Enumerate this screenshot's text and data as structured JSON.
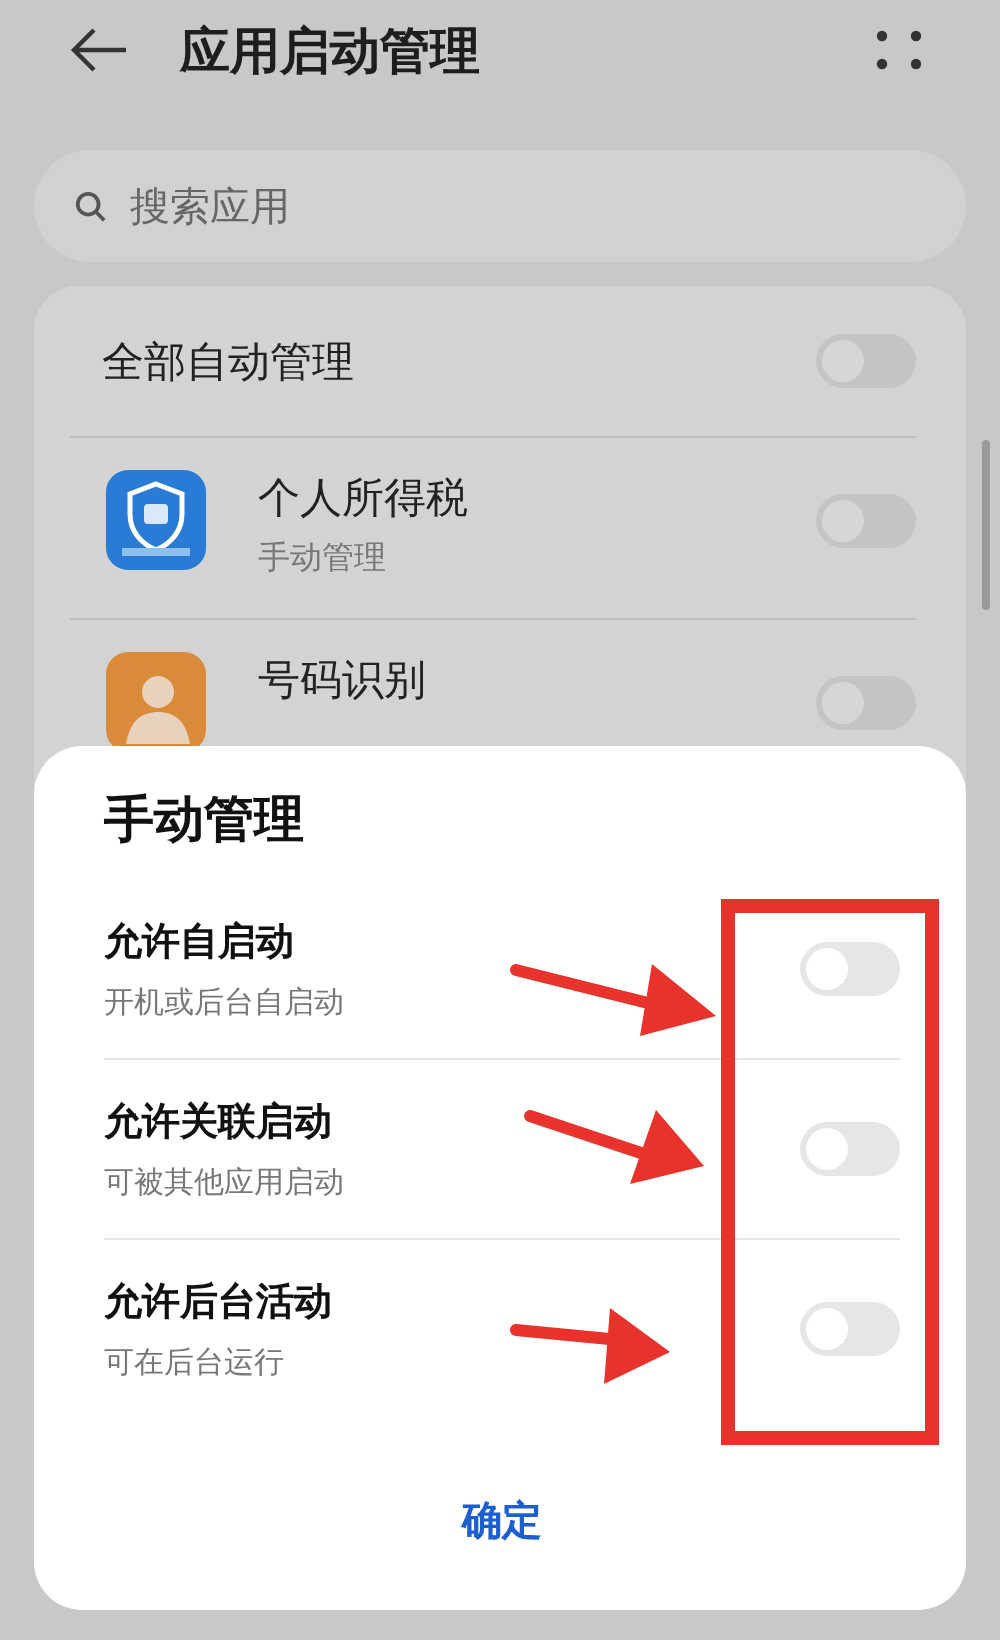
{
  "header": {
    "title": "应用启动管理"
  },
  "search": {
    "placeholder": "搜索应用"
  },
  "all_auto": {
    "label": "全部自动管理",
    "on": false
  },
  "apps": [
    {
      "name": "个人所得税",
      "status": "手动管理",
      "on": false
    },
    {
      "name": "号码识别",
      "on": false
    }
  ],
  "dialog": {
    "title": "手动管理",
    "options": [
      {
        "label": "允许自启动",
        "description": "开机或后台自启动",
        "on": false
      },
      {
        "label": "允许关联启动",
        "description": "可被其他应用启动",
        "on": false
      },
      {
        "label": "允许后台活动",
        "description": "可在后台运行",
        "on": false
      }
    ],
    "confirm": "确定"
  }
}
